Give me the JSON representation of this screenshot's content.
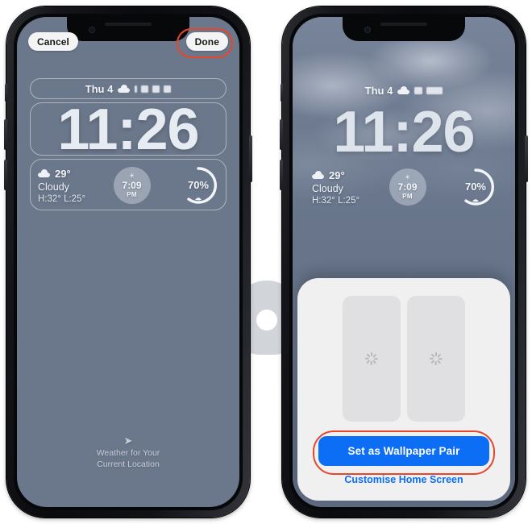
{
  "scene": {
    "description": "iOS 16 lock screen wallpaper setup, two iPhone screens side by side",
    "background_color": "#ffffff",
    "accent_blue": "#0b6ef5",
    "highlight_ring_color": "#e8462a"
  },
  "watermark": {
    "name": "site-watermark"
  },
  "left_phone": {
    "name": "iphone-edit-mode",
    "topbar": {
      "cancel_label": "Cancel",
      "done_label": "Done",
      "done_highlighted": true
    },
    "lock_screen": {
      "date": "Thu 4",
      "date_icon": "cloud-icon",
      "time": "11:26",
      "weather": {
        "icon": "cloud-icon",
        "temperature": "29°",
        "condition": "Cloudy",
        "high_low": "H:32° L:25°"
      },
      "sunset_widget": {
        "icon": "sunset-icon",
        "time": "7:09",
        "meridiem": "PM"
      },
      "humidity_widget": {
        "value": "70%",
        "icon": "umbrella-icon",
        "percent": 70
      },
      "attribution_icon": "location-arrow-icon",
      "attribution_line1": "Weather for Your",
      "attribution_line2": "Current Location"
    }
  },
  "right_phone": {
    "name": "iphone-wallpaper-confirm",
    "lock_screen": {
      "date": "Thu 4",
      "date_icon": "cloud-icon",
      "time": "11:26",
      "weather": {
        "icon": "cloud-icon",
        "temperature": "29°",
        "condition": "Cloudy",
        "high_low": "H:32° L:25°"
      },
      "sunset_widget": {
        "icon": "sunset-icon",
        "time": "7:09",
        "meridiem": "PM"
      },
      "humidity_widget": {
        "value": "70%",
        "icon": "umbrella-icon",
        "percent": 70
      }
    },
    "sheet": {
      "preview_left": {
        "state": "loading",
        "icon": "activity-spinner"
      },
      "preview_right": {
        "state": "loading",
        "icon": "activity-spinner"
      },
      "primary_button_label": "Set as Wallpaper Pair",
      "primary_button_highlighted": true,
      "secondary_link_label": "Customise Home Screen"
    }
  }
}
